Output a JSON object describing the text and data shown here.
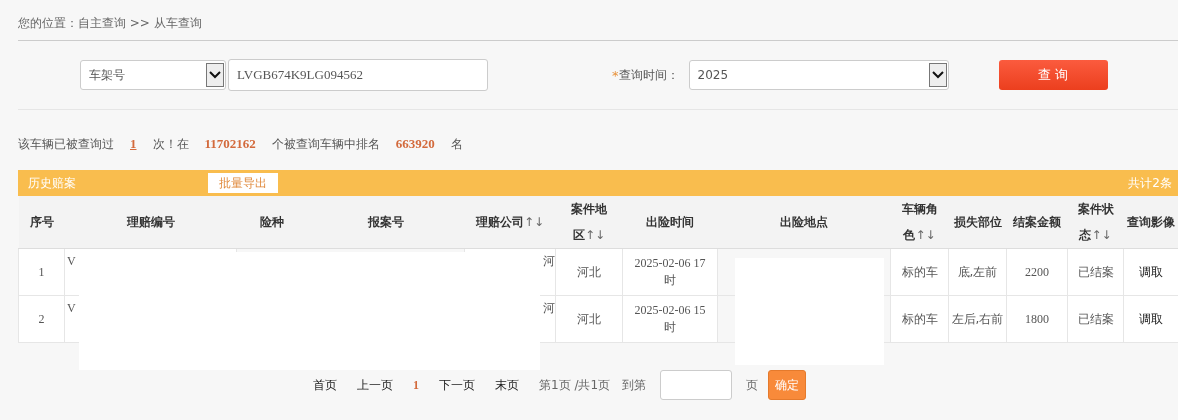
{
  "breadcrumb": {
    "label": "您的位置：",
    "path": "自主查询 >> 从车查询"
  },
  "search": {
    "type_select": "车架号",
    "vin": "LVGB674K9LG094562",
    "required_mark": "*",
    "time_label": "查询时间：",
    "time_select": "2025",
    "button": "查 询"
  },
  "stats": [
    {
      "kind": "text",
      "text": "该车辆已被查询过"
    },
    {
      "kind": "link",
      "text": "1"
    },
    {
      "kind": "text",
      "text": "次！在"
    },
    {
      "kind": "number",
      "text": "11702162"
    },
    {
      "kind": "text",
      "text": "个被查询车辆中排名"
    },
    {
      "kind": "number",
      "text": "663920"
    },
    {
      "kind": "text",
      "text": "名"
    }
  ],
  "history": {
    "title": "历史赔案",
    "export_button": "批量导出",
    "total": "共计2条",
    "columns": [
      {
        "label": "序号"
      },
      {
        "label": "理赔编号"
      },
      {
        "label": "险种"
      },
      {
        "label": "报案号"
      },
      {
        "label": "理赔公司",
        "sort": "↑↓"
      },
      {
        "label": "案件地区",
        "sort": "↑↓"
      },
      {
        "label": "出险时间"
      },
      {
        "label": "出险地点"
      },
      {
        "label": "车辆角色",
        "sort": "↑↓"
      },
      {
        "label": "损失部位"
      },
      {
        "label": "结案金额"
      },
      {
        "label": "案件状态",
        "sort": "↑↓"
      },
      {
        "label": "查询影像"
      }
    ],
    "rows": [
      {
        "cells": [
          "1",
          "V",
          "",
          "",
          "河",
          "河北",
          "2025-02-06 17时",
          "",
          "标的车",
          "底,左前",
          "2200",
          "已结案",
          "调取"
        ]
      },
      {
        "cells": [
          "2",
          "V",
          "",
          "",
          "河",
          "河北",
          "2025-02-06 15时",
          "",
          "标的车",
          "左后,右前",
          "1800",
          "已结案",
          "调取"
        ]
      }
    ]
  },
  "pagination": {
    "first": "首页",
    "prev": "上一页",
    "current": "1",
    "next": "下一页",
    "last": "末页",
    "info": "第1页 /共1页",
    "goto_label": "到第",
    "page_unit": "页",
    "confirm": "确定"
  }
}
